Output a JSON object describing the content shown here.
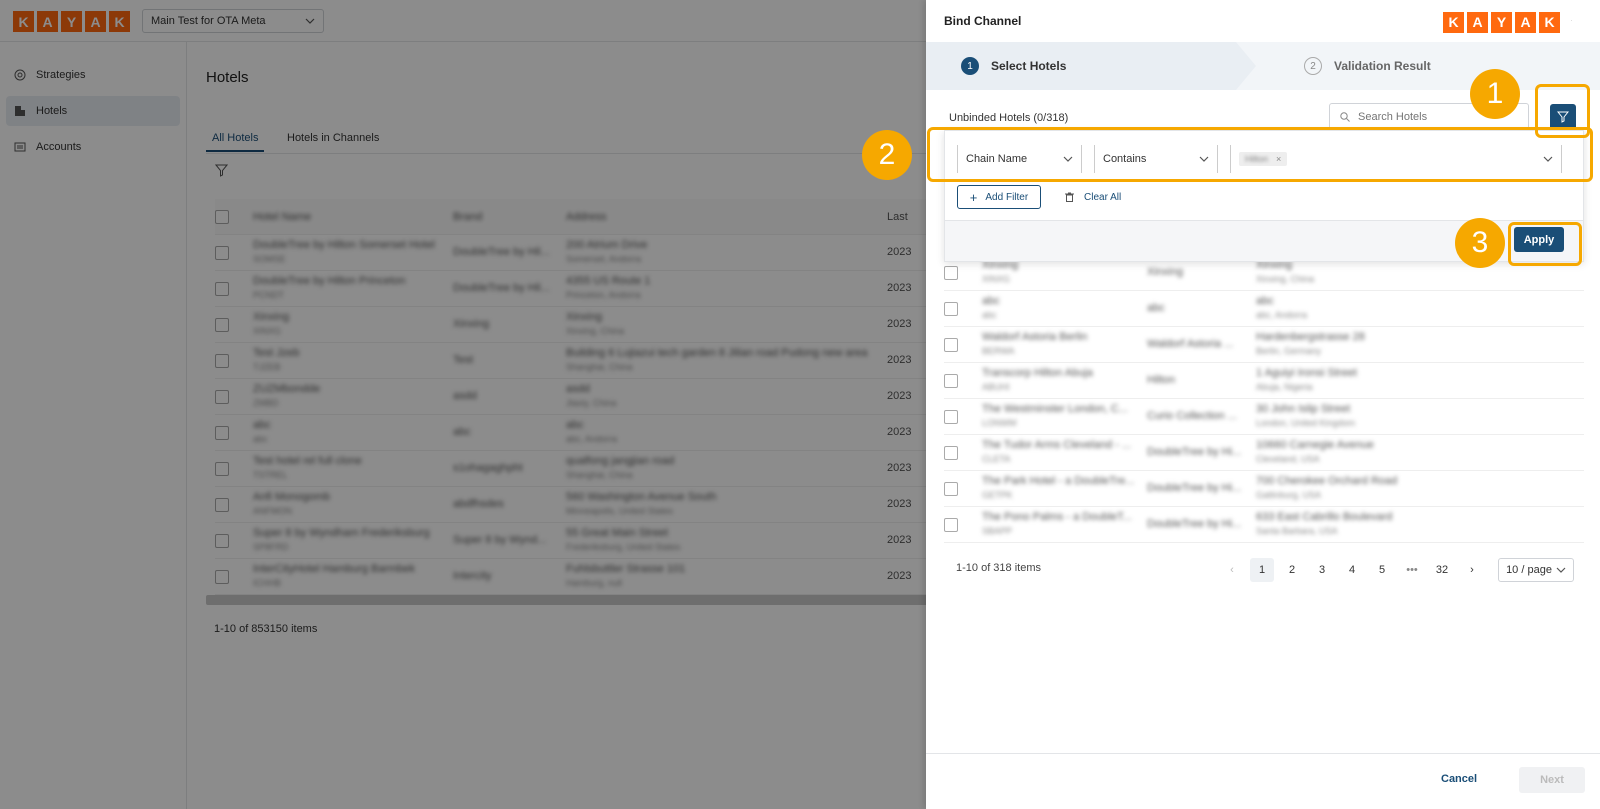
{
  "app": {
    "brand_letters": [
      "K",
      "A",
      "Y",
      "A",
      "K"
    ],
    "account_selector": "Main Test for OTA Meta",
    "sidebar": [
      {
        "label": "Strategies",
        "icon": "target-icon"
      },
      {
        "label": "Hotels",
        "icon": "building-icon"
      },
      {
        "label": "Accounts",
        "icon": "accounts-icon"
      }
    ],
    "page_title": "Hotels",
    "tabs": [
      "All Hotels",
      "Hotels in Channels"
    ],
    "table_headers": [
      "Hotel Name",
      "Brand",
      "Address",
      "Last"
    ],
    "rows": [
      {
        "name": "DoubleTree by Hilton Somerset Hotel",
        "id": "SOMSE",
        "brand": "DoubleTree by Hil...",
        "addr": "200 Atrium Drive",
        "addr2": "Somerset, Andorra"
      },
      {
        "name": "DoubleTree by Hilton Princeton",
        "id": "PCNDT",
        "brand": "DoubleTree by Hil...",
        "addr": "4355 US Route 1",
        "addr2": "Princeton, Andorra"
      },
      {
        "name": "Xinxing",
        "id": "XINXG",
        "brand": "Xinxing",
        "addr": "Xinxing",
        "addr2": "Xinxing, China"
      },
      {
        "name": "Test Jzeb",
        "id": "TJZEB",
        "brand": "Test",
        "addr": "Building 6 Lujiazui tech garden 8 Jilian road Pudong new area",
        "addr2": "Shanghai, China"
      },
      {
        "name": "ZUZMbondde",
        "id": "ZMBD",
        "brand": "asdd",
        "addr": "asdd",
        "addr2": "Jiaxiy, China"
      },
      {
        "name": "abc",
        "id": "abc",
        "brand": "abc",
        "addr": "abc",
        "addr2": "abc, Andorra"
      },
      {
        "name": "Test hotel rel full clone",
        "id": "TSTREL",
        "brand": "s1ohagaghpht",
        "addr": "qualfong jangjian road",
        "addr2": "Shanghai, China"
      },
      {
        "name": "Anfi Monogomb",
        "id": "ANFMON",
        "brand": "abdfhsdes",
        "addr": "560 Washington Avenue South",
        "addr2": "Minneapolis, United States"
      },
      {
        "name": "Super 8 by Wyndham Frederiksburg",
        "id": "SP8FRD",
        "brand": "Super 8 by Wynd...",
        "addr": "55 Great Main Street",
        "addr2": "Frederiksburg, United States"
      },
      {
        "name": "InterCityHotel Hamburg Barmbek",
        "id": "ICHHB",
        "brand": "Intercity",
        "addr": "Fuhlsbuttler Strasse 101",
        "addr2": "Hamburg, null"
      }
    ],
    "times": [
      "2023",
      "2023",
      "2023",
      "2023",
      "2023",
      "2023",
      "2023",
      "2023",
      "2023",
      "2023"
    ],
    "total_items": "1-10 of 853150 items"
  },
  "drawer": {
    "title": "Bind Channel",
    "steps": [
      {
        "num": "1",
        "label": "Select Hotels"
      },
      {
        "num": "2",
        "label": "Validation Result"
      }
    ],
    "list_title": "Unbinded Hotels (0/318)",
    "search_placeholder": "Search Hotels",
    "filter": {
      "field": "Chain Name",
      "operator": "Contains",
      "value_tag": "Hilton",
      "add_filter": "Add Filter",
      "clear_all": "Clear All",
      "apply": "Apply"
    },
    "rows": [
      {
        "name": "Xinxing",
        "id": "XINXG",
        "chain": "Xinxing",
        "addr": "Xinxing",
        "addr2": "Xinxing, China"
      },
      {
        "name": "abc",
        "id": "abc",
        "chain": "abc",
        "addr": "abc",
        "addr2": "abc, Andorra"
      },
      {
        "name": "Waldorf Astoria Berlin",
        "id": "BERWA",
        "chain": "Waldorf Astoria ...",
        "addr": "Hardenbergstrasse 28",
        "addr2": "Berlin, Germany"
      },
      {
        "name": "Transcorp Hilton Abuja",
        "id": "ABUHI",
        "chain": "Hilton",
        "addr": "1 Aguiyi Ironsi Street",
        "addr2": "Abuja, Nigeria"
      },
      {
        "name": "The Westminster London, C...",
        "id": "LONWM",
        "chain": "Curio Collection ...",
        "addr": "30 John Islip Street",
        "addr2": "London, United Kingdom"
      },
      {
        "name": "The Tudor Arms Cleveland - ...",
        "id": "CLETA",
        "chain": "DoubleTree by Hi...",
        "addr": "10660 Carnegie Avenue",
        "addr2": "Cleveland, USA"
      },
      {
        "name": "The Park Hotel - a DoubleTre...",
        "id": "GETPK",
        "chain": "DoubleTree by Hi...",
        "addr": "700 Cherokee Orchard Road",
        "addr2": "Gatlinburg, USA"
      },
      {
        "name": "The Pono Palms - a DoubleT...",
        "id": "SBAPP",
        "chain": "DoubleTree by Hi...",
        "addr": "633 East Cabrillo Boulevard",
        "addr2": "Santa Barbara, USA"
      }
    ],
    "pagination": {
      "summary": "1-10 of 318 items",
      "pages": [
        "1",
        "2",
        "3",
        "4",
        "5",
        "•••",
        "32"
      ],
      "page_size": "10 / page"
    },
    "cancel": "Cancel",
    "next": "Next"
  },
  "callouts": [
    "1",
    "2",
    "3"
  ],
  "colors": {
    "brand_orange": "#ff690f",
    "primary": "#1a4e77",
    "callout": "#f6a800"
  }
}
